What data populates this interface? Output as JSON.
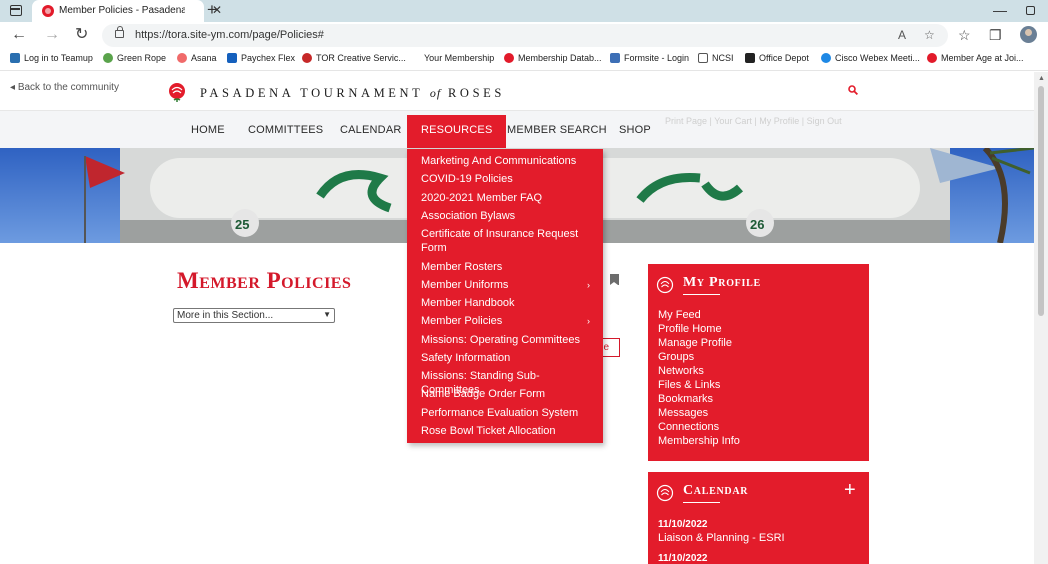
{
  "browser": {
    "tab_title": "Member Policies - Pasadena Tou",
    "url": "https://tora.site-ym.com/page/Policies#",
    "bookmarks": [
      {
        "label": "Log in to Teamup",
        "color": "#2a6fb0"
      },
      {
        "label": "Green Rope",
        "color": "#5aa34b"
      },
      {
        "label": "Asana",
        "color": "#f06a6a"
      },
      {
        "label": "Paychex Flex",
        "color": "#1560bd"
      },
      {
        "label": "TOR Creative Servic...",
        "color": "#c62828"
      },
      {
        "label": "Your Membership",
        "color": "#ffffff"
      },
      {
        "label": "Membership Datab...",
        "color": "#e21a2a"
      },
      {
        "label": "Formsite - Login",
        "color": "#3d6fb6"
      },
      {
        "label": "NCSI",
        "color": "#ffffff"
      },
      {
        "label": "Office Depot",
        "color": "#222222"
      },
      {
        "label": "Cisco Webex Meeti...",
        "color": "#1e88e5"
      },
      {
        "label": "Member Age at Joi...",
        "color": "#e21a2a"
      }
    ]
  },
  "header": {
    "back_link": "Back to the community",
    "brand_part1": "PASADENA TOURNAMENT",
    "brand_of": "of",
    "brand_part2": "ROSES",
    "util_links": "Print Page | Your Cart | My Profile | Sign Out"
  },
  "mainnav": {
    "items": [
      "HOME",
      "COMMITTEES",
      "CALENDAR",
      "RESOURCES",
      "MEMBER SEARCH",
      "SHOP"
    ],
    "active": "RESOURCES"
  },
  "resources_menu": [
    {
      "label": "Marketing And Communications",
      "has_submenu": false
    },
    {
      "label": "COVID-19 Policies",
      "has_submenu": false
    },
    {
      "label": "2020-2021 Member FAQ",
      "has_submenu": false
    },
    {
      "label": "Association Bylaws",
      "has_submenu": false
    },
    {
      "label": "Certificate of Insurance Request Form",
      "has_submenu": false
    },
    {
      "label": "Member Rosters",
      "has_submenu": false
    },
    {
      "label": "Member Uniforms",
      "has_submenu": true
    },
    {
      "label": "Member Handbook",
      "has_submenu": false
    },
    {
      "label": "Member Policies",
      "has_submenu": true
    },
    {
      "label": "Missions: Operating Committees",
      "has_submenu": false
    },
    {
      "label": "Safety Information",
      "has_submenu": false
    },
    {
      "label": "Missions: Standing Sub-Committees",
      "has_submenu": false
    },
    {
      "label": "Name Badge Order Form",
      "has_submenu": false
    },
    {
      "label": "Performance Evaluation System",
      "has_submenu": false
    },
    {
      "label": "Rose Bowl Ticket Allocation",
      "has_submenu": false
    }
  ],
  "main": {
    "page_title": "Member Policies",
    "section_select": "More in this Section...",
    "partial_button_text": "ge"
  },
  "sidebar": {
    "profile": {
      "title": "My Profile",
      "links": [
        "My Feed",
        "Profile Home",
        "Manage Profile",
        "Groups",
        "Networks",
        "Files & Links",
        "Bookmarks",
        "Messages",
        "Connections",
        "Membership Info"
      ]
    },
    "calendar": {
      "title": "Calendar",
      "add_label": "+",
      "events": [
        {
          "date": "11/10/2022",
          "title": "Liaison & Planning - ESRI"
        },
        {
          "date": "11/10/2022",
          "title": ""
        }
      ]
    }
  },
  "colors": {
    "brand_red": "#e31c2b",
    "title_red": "#d4192b",
    "nav_bg": "#f4f5f7"
  }
}
